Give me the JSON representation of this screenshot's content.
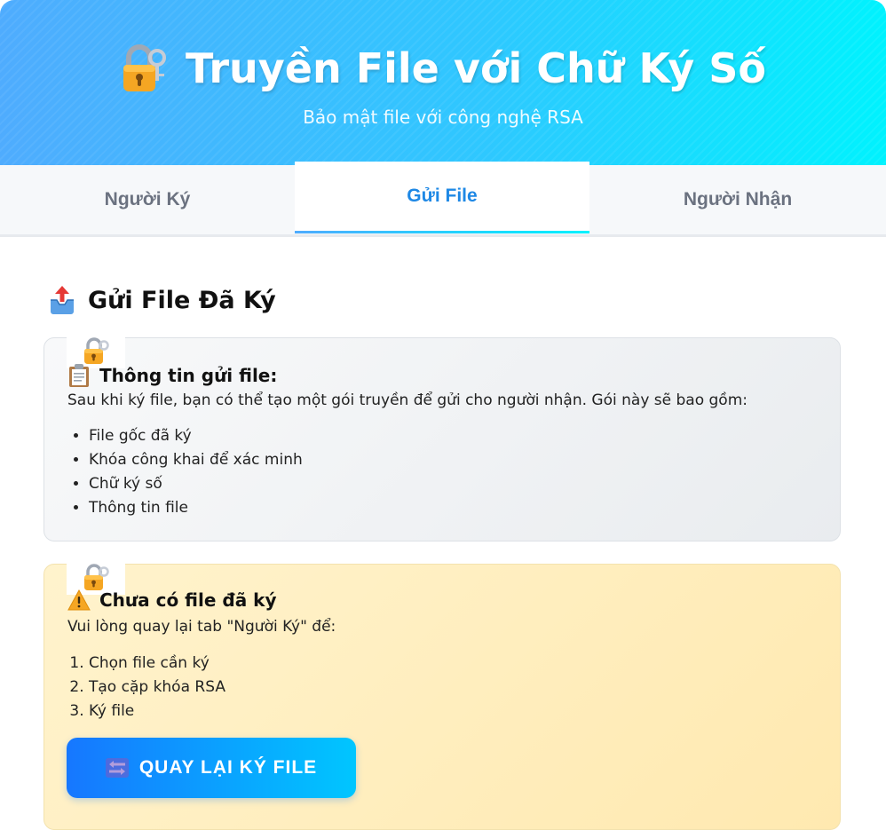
{
  "header": {
    "title": "Truyền File với Chữ Ký Số",
    "subtitle": "Bảo mật file với công nghệ RSA",
    "icon": "lock-with-key-icon"
  },
  "tabs": [
    {
      "label": "Người Ký",
      "active": false
    },
    {
      "label": "Gửi File",
      "active": true
    },
    {
      "label": "Người Nhận",
      "active": false
    }
  ],
  "main": {
    "section_title": "Gửi File Đã Ký",
    "section_icon": "outbox-tray-icon",
    "info_card": {
      "badge_icon": "lock-with-key-icon",
      "heading": "Thông tin gửi file:",
      "heading_icon": "clipboard-icon",
      "text": "Sau khi ký file, bạn có thể tạo một gói truyền để gửi cho người nhận. Gói này sẽ bao gồm:",
      "items": [
        "File gốc đã ký",
        "Khóa công khai để xác minh",
        "Chữ ký số",
        "Thông tin file"
      ]
    },
    "warning_card": {
      "badge_icon": "lock-with-key-icon",
      "heading": "Chưa có file đã ký",
      "heading_icon": "warning-icon",
      "text": "Vui lòng quay lại tab \"Người Ký\" để:",
      "steps": [
        "Chọn file cần ký",
        "Tạo cặp khóa RSA",
        "Ký file"
      ],
      "button_label": "QUAY LẠI KÝ FILE",
      "button_icon": "left-arrows-icon"
    }
  },
  "colors": {
    "header_gradient_start": "#4facfe",
    "header_gradient_end": "#00f2fe",
    "active_tab": "#1e88e5",
    "warning_bg": "#fff3cd",
    "button_start": "#1677ff",
    "button_end": "#00c6ff"
  }
}
